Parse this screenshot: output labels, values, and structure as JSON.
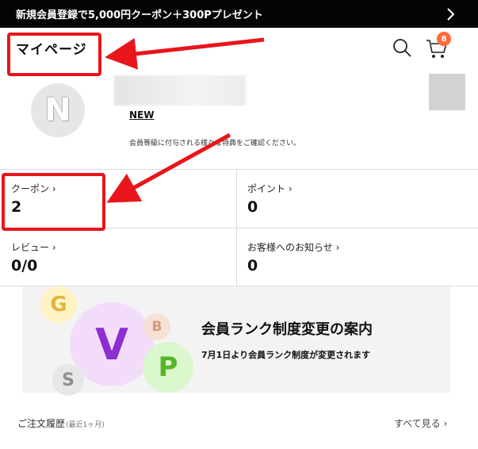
{
  "promo": {
    "text": "新規会員登録で5,000円クーポン＋300Pプレゼント",
    "chevron_icon": "chevron-right-icon"
  },
  "header": {
    "title": "マイページ",
    "search_icon": "search-icon",
    "cart_icon": "cart-icon",
    "cart_count": "8"
  },
  "profile": {
    "avatar_letter": "N",
    "rank": "NEW",
    "rank_description": "会員等級に付与される様々な特典をご確認ください。"
  },
  "stats": [
    {
      "label": "クーポン ›",
      "value": "2"
    },
    {
      "label": "ポイント ›",
      "value": "0"
    },
    {
      "label": "レビュー ›",
      "value": "0/0"
    },
    {
      "label": "お客様へのお知らせ ›",
      "value": "0"
    }
  ],
  "banner": {
    "title": "会員ランク制度変更の案内",
    "subtitle": "7月1日より会員ランク制度が変更されます",
    "badges": [
      "G",
      "V",
      "B",
      "P",
      "S"
    ]
  },
  "orders": {
    "title": "ご注文履歴",
    "period": "(最近1ヶ月)",
    "see_all": "すべて見る ›"
  },
  "colors": {
    "promo_bg": "#050505",
    "cart_badge": "#ff6a3d",
    "annotation": "#e8151b"
  }
}
